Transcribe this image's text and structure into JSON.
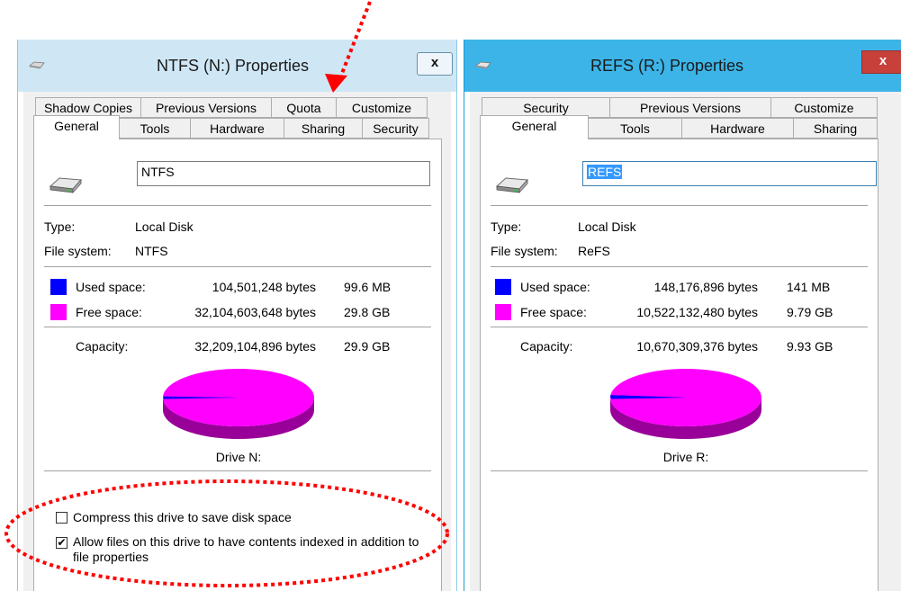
{
  "ntfs": {
    "title": "NTFS (N:) Properties",
    "close_label": "x",
    "tabs_top": [
      "Shadow Copies",
      "Previous Versions",
      "Quota",
      "Customize"
    ],
    "tabs_bottom": [
      "General",
      "Tools",
      "Hardware",
      "Sharing",
      "Security"
    ],
    "volume_label": "NTFS",
    "type_label": "Type:",
    "type_value": "Local Disk",
    "fs_label": "File system:",
    "fs_value": "NTFS",
    "used_label": "Used space:",
    "used_bytes": "104,501,248 bytes",
    "used_size": "99.6 MB",
    "free_label": "Free space:",
    "free_bytes": "32,104,603,648 bytes",
    "free_size": "29.8 GB",
    "capacity_label": "Capacity:",
    "capacity_bytes": "32,209,104,896 bytes",
    "capacity_size": "29.9 GB",
    "drive_label": "Drive N:",
    "used_fraction": 0.0032,
    "compress_label": "Compress this drive to save disk space",
    "compress_checked": false,
    "index_label_line1": "Allow files on this drive to have contents indexed in addition to",
    "index_label_line2": "file properties",
    "index_checked": true
  },
  "refs": {
    "title": "REFS (R:) Properties",
    "close_label": "x",
    "tabs_top": [
      "Security",
      "Previous Versions",
      "Customize"
    ],
    "tabs_bottom": [
      "General",
      "Tools",
      "Hardware",
      "Sharing"
    ],
    "volume_label": "REFS",
    "type_label": "Type:",
    "type_value": "Local Disk",
    "fs_label": "File system:",
    "fs_value": "ReFS",
    "used_label": "Used space:",
    "used_bytes": "148,176,896 bytes",
    "used_size": "141 MB",
    "free_label": "Free space:",
    "free_bytes": "10,522,132,480 bytes",
    "free_size": "9.79 GB",
    "capacity_label": "Capacity:",
    "capacity_bytes": "10,670,309,376 bytes",
    "capacity_size": "9.93 GB",
    "drive_label": "Drive R:",
    "used_fraction": 0.0139
  },
  "colors": {
    "used": "#0000ff",
    "free": "#ff00ff",
    "free_side": "#990099",
    "annotation": "#ff0000"
  },
  "icons": [
    "drive-icon",
    "check-icon"
  ]
}
